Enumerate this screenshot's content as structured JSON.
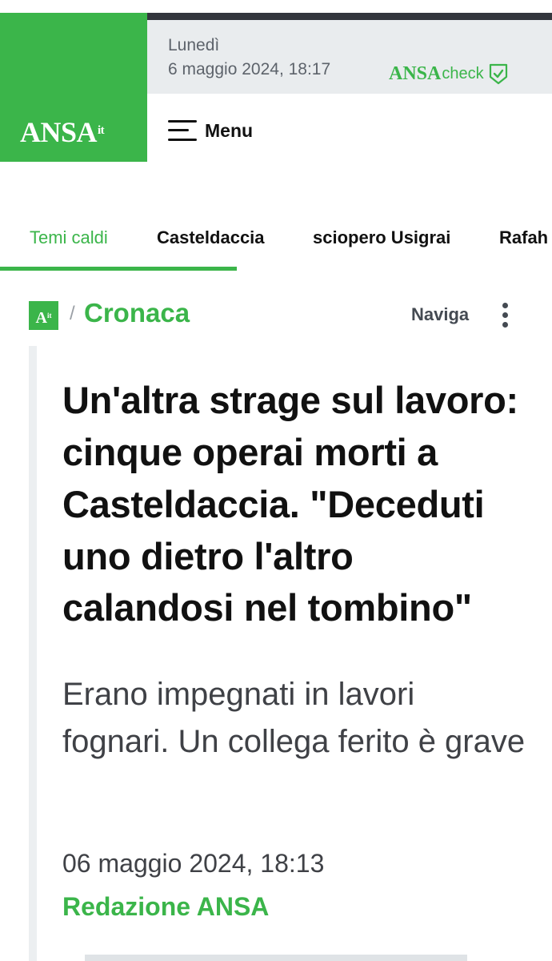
{
  "header": {
    "logo": "ANSA",
    "logo_suffix": "it",
    "day": "Lunedì",
    "datetime": "6 maggio 2024, 18:17",
    "check_brand": "ANSA",
    "check_word": "check",
    "menu_label": "Menu",
    "accent_color": "#3bb54a"
  },
  "hot_topics": {
    "tabs": [
      {
        "label": "Temi caldi",
        "active": true
      },
      {
        "label": "Casteldaccia"
      },
      {
        "label": "sciopero Usigrai"
      },
      {
        "label": "Rafah"
      }
    ]
  },
  "breadcrumb": {
    "logo": "A",
    "logo_suffix": "it",
    "separator": "/",
    "section": "Cronaca",
    "naviga_label": "Naviga"
  },
  "article": {
    "headline": "Un'altra strage sul lavoro: cinque operai morti a Casteldaccia. \"Deceduti uno dietro l'altro calandosi nel tombino\"",
    "subtitle": "Erano impegnati in lavori fognari. Un collega ferito è grave",
    "date": "06 maggio 2024, 18:13",
    "author": "Redazione ANSA"
  }
}
